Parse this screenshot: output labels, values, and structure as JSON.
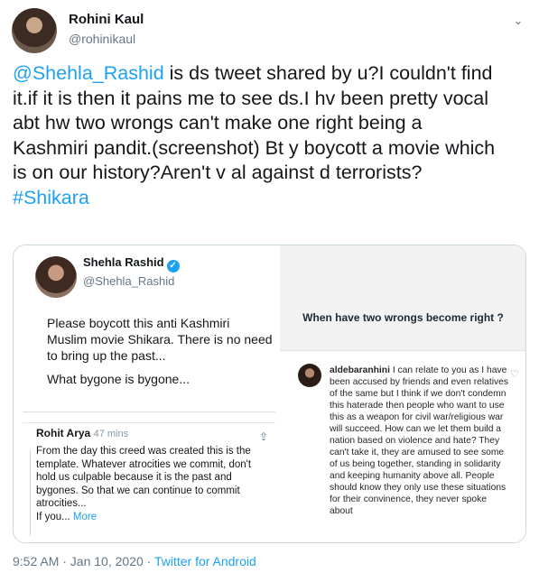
{
  "tweet": {
    "author_name": "Rohini Kaul",
    "author_handle": "@rohinikaul",
    "caret_icon": "chevron-down-icon",
    "text_mention": "@Shehla_Rashid",
    "text_body": " is ds tweet shared by u?I couldn't find\nit.if it is then it pains me to see ds.I hv been pretty vocal\nabt hw two wrongs can't make one right being a\nKashmiri pandit.(screenshot) Bt y boycott a movie which\nis on our history?Aren't v al against d terrorists?\n",
    "text_hashtag": "#Shikara",
    "time": "9:52 AM · Jan 10, 2020 · ",
    "source": "Twitter for Android"
  },
  "media": {
    "quoted_tweet": {
      "name": "Shehla Rashid",
      "handle": "@Shehla_Rashid",
      "body": "Please boycott this anti Kashmiri Muslim movie Shikara. There is no need to bring up the past...",
      "body2": "What bygone is bygone..."
    },
    "reply": {
      "name": "Rohit Arya",
      "time": "47 mins",
      "body": "From the day this creed was created this is the template. Whatever atrocities we commit, don't hold us culpable because it is the past and bygones. So that we can continue to commit atrocities...",
      "more_prefix": "If you... ",
      "more": "More"
    },
    "instagram": {
      "question": "When have two wrongs become right ?",
      "username": "aldebaranhini",
      "comment": " I can relate to you as I have been accused by friends and even relatives of the same but I think if we don't condemn this haterade then people who want to use this as a weapon for civil war/religious war will succeed. How can we let them build a nation based on violence and hate? They can't take it, they are amused to see some of us being together, standing in solidarity and keeping humanity above all. People should know they only use these situations for their convinence, they never spoke about"
    }
  },
  "colors": {
    "link": "#1da1f2",
    "muted": "#657786"
  }
}
